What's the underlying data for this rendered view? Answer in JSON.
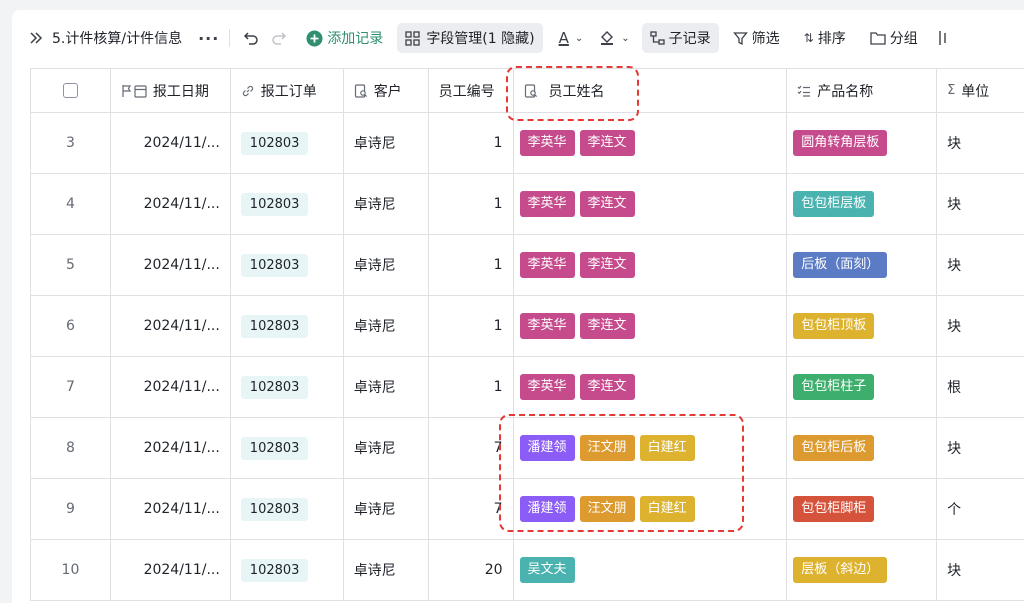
{
  "toolbar": {
    "title": "5.计件核算/计件信息",
    "add_record": "添加记录",
    "field_manage": "字段管理(1 隐藏)",
    "sub_record": "子记录",
    "filter": "筛选",
    "sort": "排序",
    "group": "分组"
  },
  "columns": {
    "date": "报工日期",
    "order": "报工订单",
    "customer": "客户",
    "emp_no": "员工编号",
    "emp_name": "员工姓名",
    "product": "产品名称",
    "unit": "单位"
  },
  "tag_colors": {
    "李英华": "#c54b8c",
    "李连文": "#c54b8c",
    "潘建领": "#8b5cf6",
    "汪文朋": "#dc9a2f",
    "白建红": "#dcb22e",
    "吴文夫": "#4ab3b0",
    "圆角转角层板": "#c54b8c",
    "包包柜层板": "#4ab3b0",
    "后板（面刻）": "#5b7cc4",
    "包包柜顶板": "#dcb22e",
    "包包柜柱子": "#3dae6b",
    "包包柜后板": "#dc9a2f",
    "包包柜脚柜": "#d4533a",
    "层板（斜边）": "#dcb22e"
  },
  "rows": [
    {
      "n": "3",
      "date": "2024/11/...",
      "order": "102803",
      "customer": "卓诗尼",
      "emp_no": "1",
      "names": [
        "李英华",
        "李连文"
      ],
      "product": "圆角转角层板",
      "unit": "块"
    },
    {
      "n": "4",
      "date": "2024/11/...",
      "order": "102803",
      "customer": "卓诗尼",
      "emp_no": "1",
      "names": [
        "李英华",
        "李连文"
      ],
      "product": "包包柜层板",
      "unit": "块"
    },
    {
      "n": "5",
      "date": "2024/11/...",
      "order": "102803",
      "customer": "卓诗尼",
      "emp_no": "1",
      "names": [
        "李英华",
        "李连文"
      ],
      "product": "后板（面刻）",
      "unit": "块"
    },
    {
      "n": "6",
      "date": "2024/11/...",
      "order": "102803",
      "customer": "卓诗尼",
      "emp_no": "1",
      "names": [
        "李英华",
        "李连文"
      ],
      "product": "包包柜顶板",
      "unit": "块"
    },
    {
      "n": "7",
      "date": "2024/11/...",
      "order": "102803",
      "customer": "卓诗尼",
      "emp_no": "1",
      "names": [
        "李英华",
        "李连文"
      ],
      "product": "包包柜柱子",
      "unit": "根"
    },
    {
      "n": "8",
      "date": "2024/11/...",
      "order": "102803",
      "customer": "卓诗尼",
      "emp_no": "7",
      "names": [
        "潘建领",
        "汪文朋",
        "白建红"
      ],
      "product": "包包柜后板",
      "unit": "块"
    },
    {
      "n": "9",
      "date": "2024/11/...",
      "order": "102803",
      "customer": "卓诗尼",
      "emp_no": "7",
      "names": [
        "潘建领",
        "汪文朋",
        "白建红"
      ],
      "product": "包包柜脚柜",
      "unit": "个"
    },
    {
      "n": "10",
      "date": "2024/11/...",
      "order": "102803",
      "customer": "卓诗尼",
      "emp_no": "20",
      "names": [
        "吴文夫"
      ],
      "product": "层板（斜边）",
      "unit": "块"
    }
  ]
}
